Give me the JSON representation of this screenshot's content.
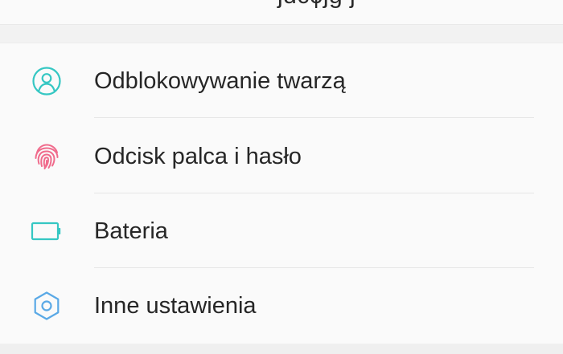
{
  "top_partial": {
    "text": "ϳɑϲɸϳɡ ϳ"
  },
  "settings": {
    "items": [
      {
        "label": "Odblokowywanie twarzą",
        "icon": "face-unlock-icon",
        "color": "#35c7c3"
      },
      {
        "label": "Odcisk palca i hasło",
        "icon": "fingerprint-icon",
        "color": "#f06b8c"
      },
      {
        "label": "Bateria",
        "icon": "battery-icon",
        "color": "#35c7c3"
      },
      {
        "label": "Inne ustawienia",
        "icon": "gear-icon",
        "color": "#5aa9e6"
      }
    ]
  }
}
